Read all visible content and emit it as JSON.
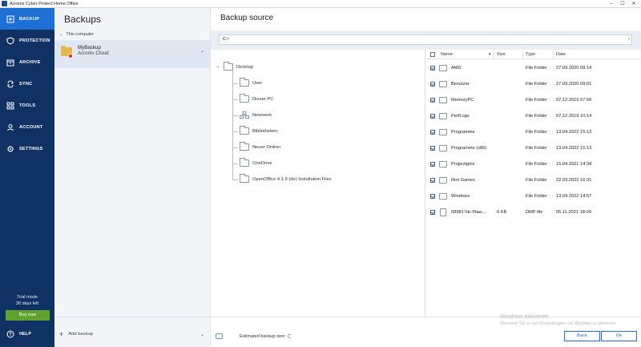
{
  "window": {
    "title": "Acronis Cyber Protect Home Office"
  },
  "nav": {
    "items": [
      {
        "label": "BACKUP",
        "icon": "backup-icon",
        "active": true
      },
      {
        "label": "PROTECTION",
        "icon": "shield-icon",
        "active": false
      },
      {
        "label": "ARCHIVE",
        "icon": "archive-icon",
        "active": false
      },
      {
        "label": "SYNC",
        "icon": "sync-icon",
        "active": false
      },
      {
        "label": "TOOLS",
        "icon": "tools-icon",
        "active": false
      },
      {
        "label": "ACCOUNT",
        "icon": "account-icon",
        "active": false
      },
      {
        "label": "SETTINGS",
        "icon": "gear-icon",
        "active": false
      }
    ],
    "trial_line1": "Trial mode",
    "trial_line2": "30 days left",
    "buy_now": "Buy now",
    "help": "HELP"
  },
  "backups": {
    "title": "Backups",
    "section": "This computer",
    "item": {
      "name": "MyBackup",
      "destination": "Acronis Cloud"
    },
    "add_backup": "Add backup"
  },
  "main": {
    "title": "Backup source",
    "path": "C:\\",
    "tree": [
      {
        "label": "Desktop",
        "toggle": "–",
        "icon": "folder"
      },
      {
        "label": "User",
        "toggle": "",
        "icon": "folder"
      },
      {
        "label": "Dieser PC",
        "toggle": "",
        "icon": "folder"
      },
      {
        "label": "Netzwerk",
        "toggle": "",
        "icon": "network"
      },
      {
        "label": "Bibliotheken",
        "toggle": "",
        "icon": "folder"
      },
      {
        "label": "Neuer Ordner",
        "toggle": "",
        "icon": "folder"
      },
      {
        "label": "OneDrive",
        "toggle": "",
        "icon": "folder"
      },
      {
        "label": "OpenOffice 4.1.9 (de) Installation Files",
        "toggle": "",
        "icon": "folder"
      }
    ],
    "columns": {
      "name": "Name",
      "size": "Size",
      "type": "Type",
      "date": "Date"
    },
    "files": [
      {
        "name": "AMD",
        "size": "",
        "type": "File Folder",
        "date": "27.09.2020 09:14",
        "checked": true
      },
      {
        "name": "Benutzer",
        "size": "",
        "type": "File Folder",
        "date": "27.09.2020 09:01",
        "checked": true
      },
      {
        "name": "MemoryPC",
        "size": "",
        "type": "File Folder",
        "date": "07.12.2019 07:59",
        "checked": true
      },
      {
        "name": "PerfLogs",
        "size": "",
        "type": "File Folder",
        "date": "07.12.2019 10:14",
        "checked": true
      },
      {
        "name": "Programme",
        "size": "",
        "type": "File Folder",
        "date": "13.04.2022 15:13",
        "checked": true
      },
      {
        "name": "Programme (x86)",
        "size": "",
        "type": "File Folder",
        "date": "13.04.2022 15:13",
        "checked": true
      },
      {
        "name": "Projectignis",
        "size": "",
        "type": "File Folder",
        "date": "15.04.2021 14:34",
        "checked": true
      },
      {
        "name": "Riot Games",
        "size": "",
        "type": "File Folder",
        "date": "22.03.2022 16:31",
        "checked": true
      },
      {
        "name": "Windows",
        "size": "",
        "type": "File Folder",
        "date": "13.04.2022 14:57",
        "checked": true
      },
      {
        "name": "589817dc-f9aa-...",
        "size": "0 KB",
        "type": "DMP file",
        "date": "05.11.2021 18:09",
        "checked": true
      }
    ],
    "estimated_label": "Estimated backup size:",
    "back": "Back",
    "ok": "Ok"
  },
  "watermark": {
    "line1": "Windows aktivieren",
    "line2": "Wechseln Sie zu den Einstellungen, um Windows zu aktivieren."
  },
  "colors": {
    "nav_bg": "#0f3163",
    "nav_active": "#1e6fd6",
    "buy_now": "#5fa22d",
    "accent": "#1e6fd6"
  }
}
